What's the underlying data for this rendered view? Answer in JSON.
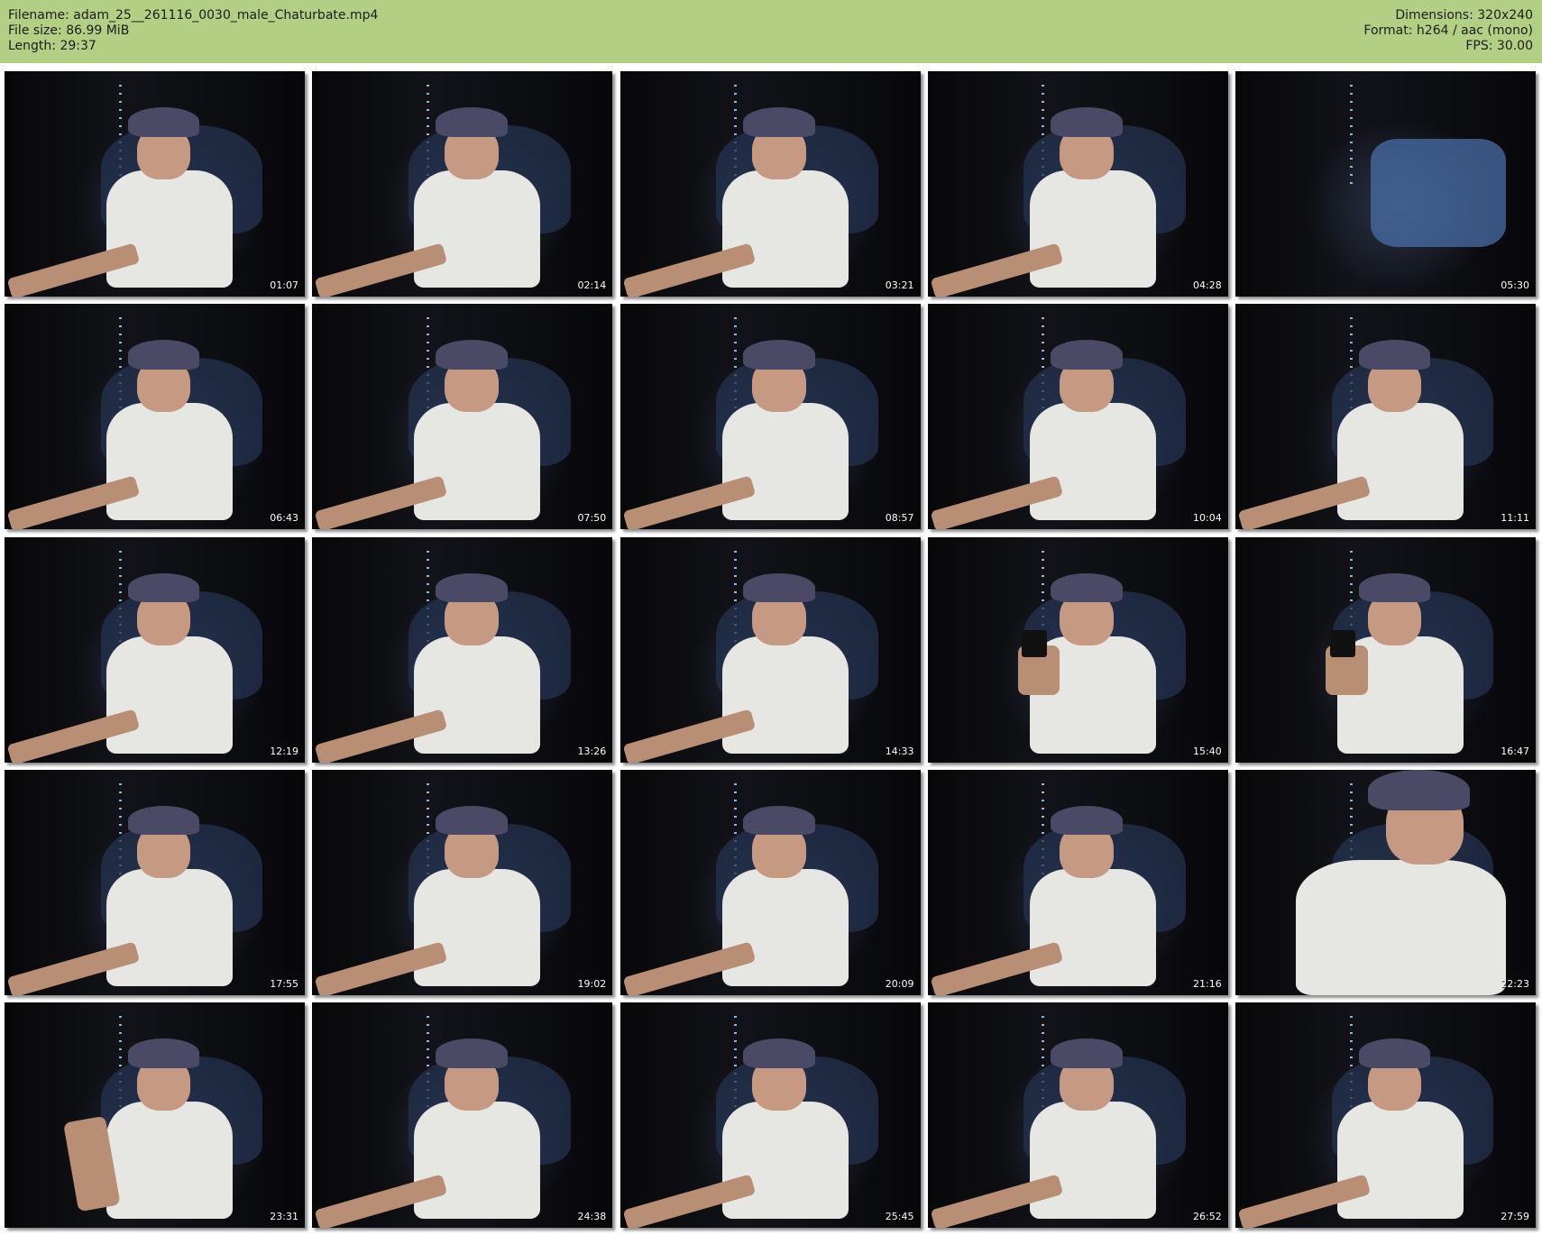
{
  "header": {
    "filename_label": "Filename: adam_25__261116_0030_male_Chaturbate.mp4",
    "filesize_label": "File size: 86.99 MiB",
    "length_label": "Length: 29:37",
    "dimensions_label": "Dimensions: 320x240",
    "format_label": "Format: h264 / aac (mono)",
    "fps_label": "FPS: 30.00"
  },
  "colors": {
    "header_background": "#b2cf83",
    "page_background": "#ffffff",
    "timestamp_text": "#ffffff"
  },
  "thumbnails": [
    {
      "timestamp": "01:07",
      "pose": "seated"
    },
    {
      "timestamp": "02:14",
      "pose": "seated"
    },
    {
      "timestamp": "03:21",
      "pose": "seated"
    },
    {
      "timestamp": "04:28",
      "pose": "seated"
    },
    {
      "timestamp": "05:30",
      "pose": "away"
    },
    {
      "timestamp": "06:43",
      "pose": "seated"
    },
    {
      "timestamp": "07:50",
      "pose": "seated"
    },
    {
      "timestamp": "08:57",
      "pose": "seated"
    },
    {
      "timestamp": "10:04",
      "pose": "seated"
    },
    {
      "timestamp": "11:11",
      "pose": "seated"
    },
    {
      "timestamp": "12:19",
      "pose": "seated"
    },
    {
      "timestamp": "13:26",
      "pose": "seated"
    },
    {
      "timestamp": "14:33",
      "pose": "seated"
    },
    {
      "timestamp": "15:40",
      "pose": "phone"
    },
    {
      "timestamp": "16:47",
      "pose": "phone"
    },
    {
      "timestamp": "17:55",
      "pose": "seated"
    },
    {
      "timestamp": "19:02",
      "pose": "seated"
    },
    {
      "timestamp": "20:09",
      "pose": "seated"
    },
    {
      "timestamp": "21:16",
      "pose": "seated"
    },
    {
      "timestamp": "22:23",
      "pose": "close"
    },
    {
      "timestamp": "23:31",
      "pose": "smoke"
    },
    {
      "timestamp": "24:38",
      "pose": "seated"
    },
    {
      "timestamp": "25:45",
      "pose": "seated"
    },
    {
      "timestamp": "26:52",
      "pose": "seated"
    },
    {
      "timestamp": "27:59",
      "pose": "seated"
    }
  ]
}
